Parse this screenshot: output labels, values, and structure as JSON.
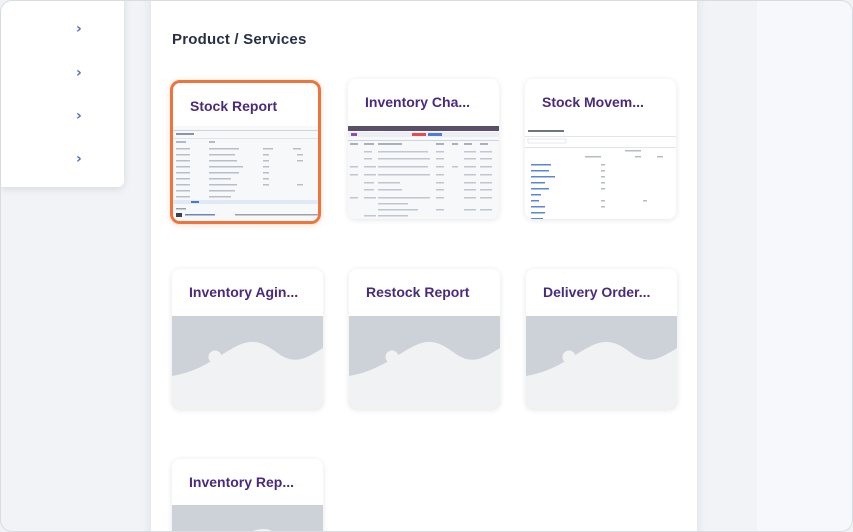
{
  "section": {
    "title": "Product / Services"
  },
  "sidebar": {
    "items": [
      {
        "icon": "chevron-right-icon"
      },
      {
        "icon": "chevron-right-icon"
      },
      {
        "icon": "chevron-right-icon"
      },
      {
        "icon": "chevron-right-icon"
      }
    ]
  },
  "cards": [
    {
      "title": "Stock Report",
      "selected": true
    },
    {
      "title": "Inventory Cha..."
    },
    {
      "title": "Stock Movem..."
    },
    {
      "title": "Inventory Agin..."
    },
    {
      "title": "Restock Report"
    },
    {
      "title": "Delivery Order..."
    },
    {
      "title": "Inventory Rep..."
    }
  ],
  "colors": {
    "accent_selected": "#f0733a",
    "card_title": "#4a2a7e",
    "chevron": "#4a6cc6"
  }
}
